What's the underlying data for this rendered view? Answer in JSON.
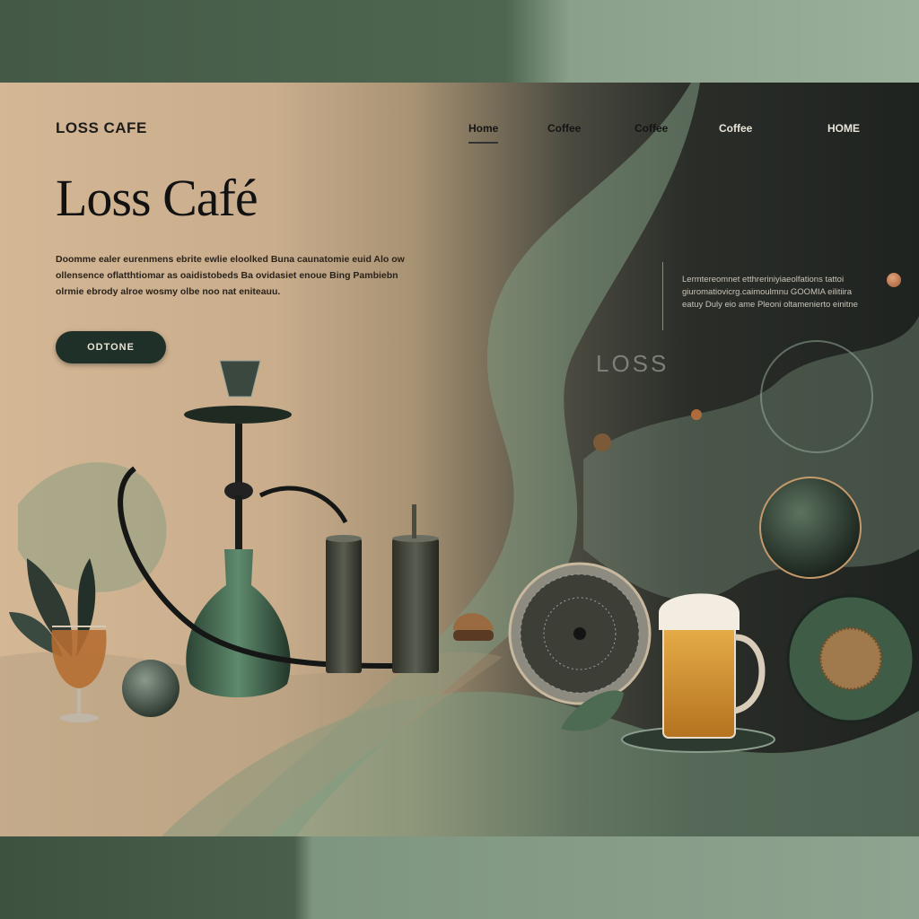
{
  "brand": {
    "name": "LOSS CAFE"
  },
  "nav": {
    "items": [
      {
        "label": "Home",
        "active": true
      },
      {
        "label": "Coffee"
      },
      {
        "label": "Coffee"
      },
      {
        "label": "Coffee"
      },
      {
        "label": "HOME"
      }
    ]
  },
  "hero": {
    "title": "Loss Café",
    "intro": "Doomme ealer eurenmens ebrite ewlie eloolked Buna caunatomie euid Alo ow ollensence oflatthtiomar as oaidistobeds Ba ovidasiet enoue Bing Pambiebn olrmie ebrody alroe wosmy olbe noo nat eniteauu.",
    "cta_label": "ODTONE",
    "side_text": "Lermtereomnet etthreriniyiaeolfations tattoi giuromatiovicrg.caimoulmnu GOOMIA eilitiira eatuy Duly eio ame Pleoni oltamenierto einitne",
    "watermark": "LOSS"
  },
  "colors": {
    "accent_dark_green": "#1e3028",
    "sage": "#7e957f",
    "tan": "#d4b795",
    "charcoal": "#1f2320"
  },
  "icons": [
    "hookah-illustration",
    "beer-glass-illustration",
    "beer-mug-illustration",
    "cocktail-shaker-illustration",
    "leaf-illustration",
    "plate-illustration",
    "sphere-illustration"
  ]
}
